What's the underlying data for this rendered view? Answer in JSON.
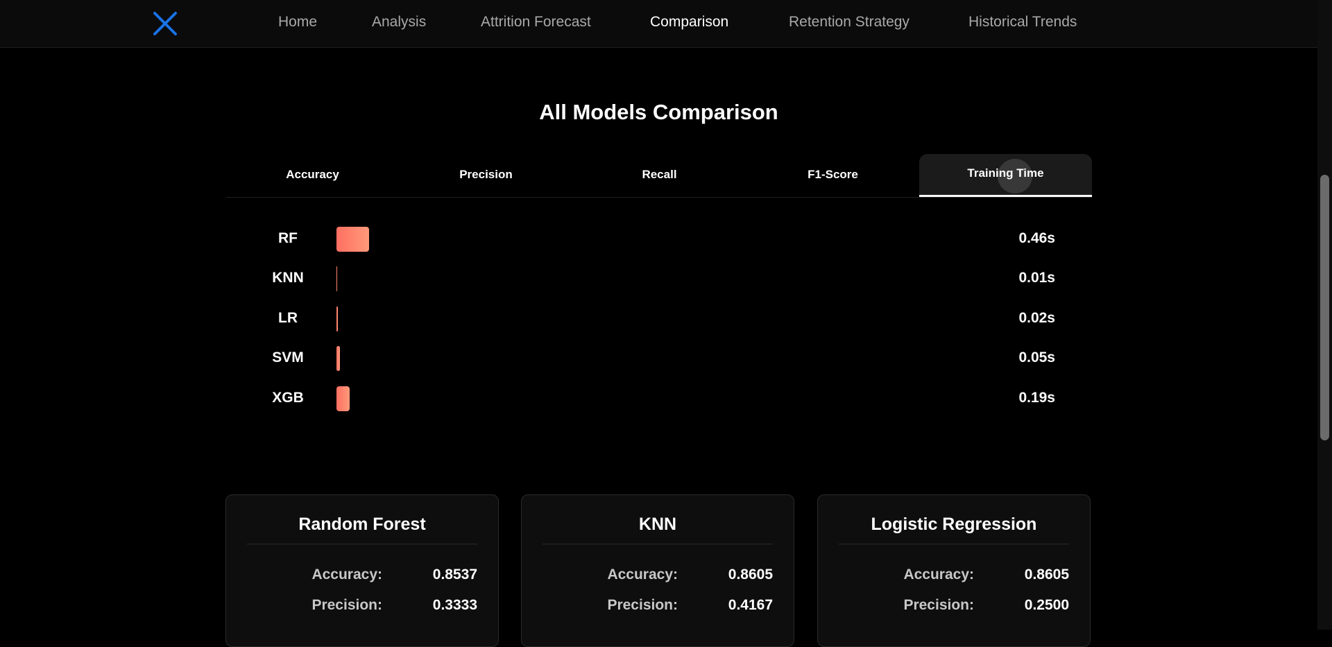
{
  "nav": {
    "logo_icon": "x-logo-icon",
    "items": [
      "Home",
      "Analysis",
      "Attrition Forecast",
      "Comparison",
      "Retention Strategy",
      "Historical Trends"
    ],
    "active": "Comparison"
  },
  "section": {
    "title": "All Models Comparison"
  },
  "tabs": {
    "items": [
      "Accuracy",
      "Precision",
      "Recall",
      "F1-Score",
      "Training Time"
    ],
    "active": "Training Time"
  },
  "chart_data": {
    "type": "bar",
    "metric": "Training Time",
    "categories": [
      "RF",
      "KNN",
      "LR",
      "SVM",
      "XGB"
    ],
    "values": [
      0.46,
      0.01,
      0.02,
      0.05,
      0.19
    ],
    "value_labels": [
      "0.46s",
      "0.01s",
      "0.02s",
      "0.05s",
      "0.19s"
    ],
    "bar_color": "#ff7a6b"
  },
  "cards": [
    {
      "title": "Random Forest",
      "metrics": [
        {
          "label": "Accuracy:",
          "value": "0.8537"
        },
        {
          "label": "Precision:",
          "value": "0.3333"
        }
      ]
    },
    {
      "title": "KNN",
      "metrics": [
        {
          "label": "Accuracy:",
          "value": "0.8605"
        },
        {
          "label": "Precision:",
          "value": "0.4167"
        }
      ]
    },
    {
      "title": "Logistic Regression",
      "metrics": [
        {
          "label": "Accuracy:",
          "value": "0.8605"
        },
        {
          "label": "Precision:",
          "value": "0.2500"
        }
      ]
    }
  ],
  "colors": {
    "background": "#000000",
    "nav_background": "#0b0b0b",
    "accent_logo": "#1a73e8",
    "bar_gradient_start": "#ff6f61",
    "bar_gradient_end": "#ff9a7a"
  }
}
